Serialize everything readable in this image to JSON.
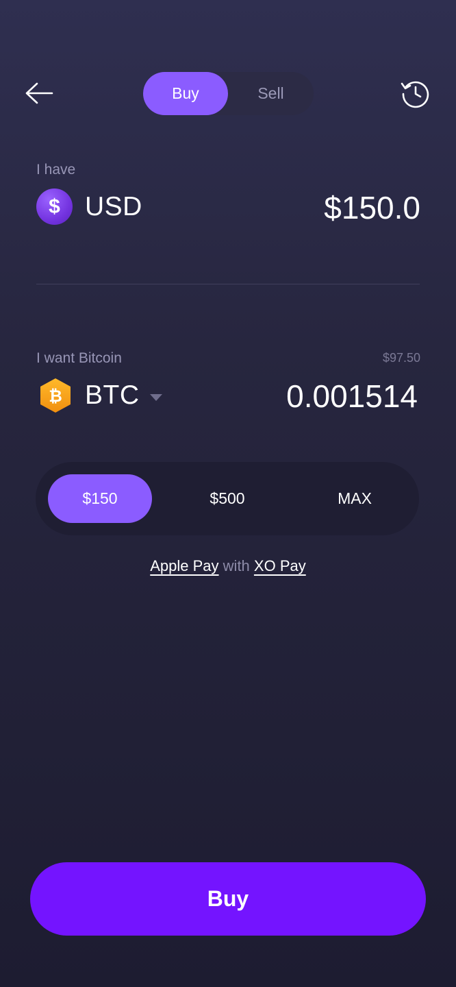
{
  "header": {
    "back_icon": "arrow-left-icon",
    "history_icon": "history-clock-icon",
    "tabs": [
      {
        "label": "Buy",
        "active": true
      },
      {
        "label": "Sell",
        "active": false
      }
    ]
  },
  "source": {
    "label": "I have",
    "currency_code": "USD",
    "icon": "dollar-coin-icon",
    "icon_glyph": "$",
    "amount": "$150.0"
  },
  "target": {
    "label": "I want Bitcoin",
    "usd_value": "$97.50",
    "currency_code": "BTC",
    "icon": "bitcoin-coin-icon",
    "icon_glyph": "₿",
    "amount": "0.001514"
  },
  "quick_amounts": [
    {
      "label": "$150",
      "selected": true
    },
    {
      "label": "$500",
      "selected": false
    },
    {
      "label": "MAX",
      "selected": false
    }
  ],
  "payment": {
    "method": "Apple Pay",
    "connector": "with",
    "provider": "XO Pay"
  },
  "action": {
    "buy_label": "Buy"
  },
  "colors": {
    "accent": "#8b5cff",
    "primary_button": "#7414ff",
    "background_top": "#2f2f50",
    "background_bottom": "#1d1c31",
    "btc_orange": "#f6a21b"
  }
}
